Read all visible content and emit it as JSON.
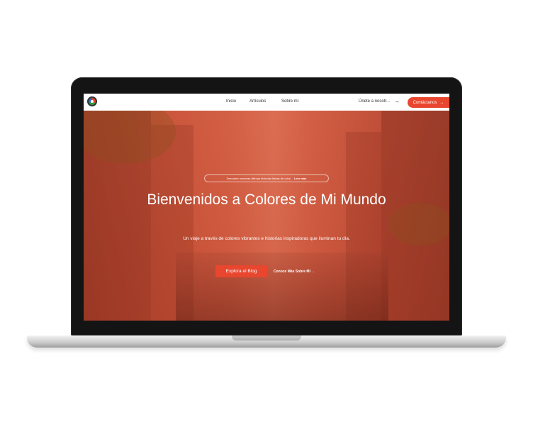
{
  "nav": {
    "links": [
      "Inicio",
      "Artículos",
      "Sobre mí"
    ],
    "join_label": "Únete a nosotr...",
    "join_icon": "arrow-right-icon",
    "contact_label": "Contáctanos",
    "contact_icon": "arrow-right-icon"
  },
  "hero": {
    "pill_text": "Descubre nuestras últimas historias llenas de color.",
    "pill_link": "Leer más",
    "title": "Bienvenidos a Colores de Mi Mundo",
    "subtitle": "Un viaje a través de colores vibrantes e historias inspiradoras que iluminan tu día.",
    "primary_cta": "Explora el Blog",
    "secondary_cta": "Conoce Más Sobre Mí →"
  },
  "colors": {
    "accent": "#e8462f",
    "hero_overlay": "#d6563c",
    "laptop_bezel": "#141414"
  }
}
